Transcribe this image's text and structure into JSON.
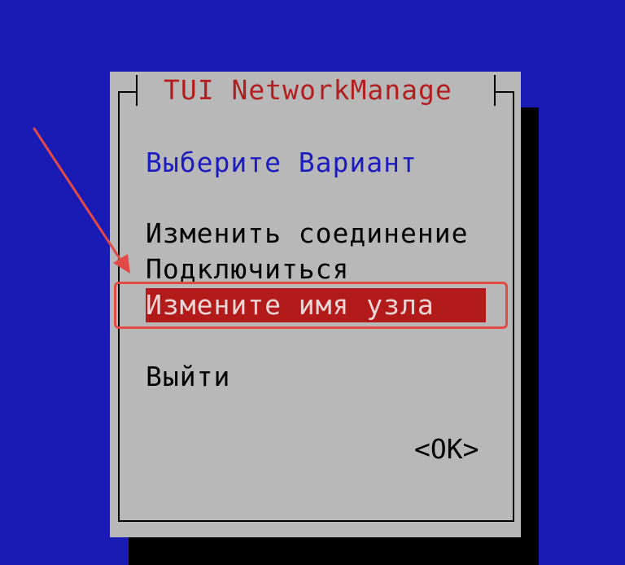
{
  "dialog": {
    "title": "TUI NetworkManage",
    "prompt": "Выберите Вариант",
    "menu_items": [
      {
        "label": "Изменить соединение",
        "selected": false
      },
      {
        "label": "Подключиться",
        "selected": false
      },
      {
        "label": "Измените имя узла",
        "selected": true
      },
      {
        "label": "Выйти",
        "selected": false
      }
    ],
    "ok_label": "<OK>"
  },
  "colors": {
    "background": "#1a1ab4",
    "dialog_bg": "#b8b8b8",
    "title": "#b21d1d",
    "prompt": "#1c1cbf",
    "selection_bg": "#b31a1a",
    "annotation": "#e14a45"
  }
}
